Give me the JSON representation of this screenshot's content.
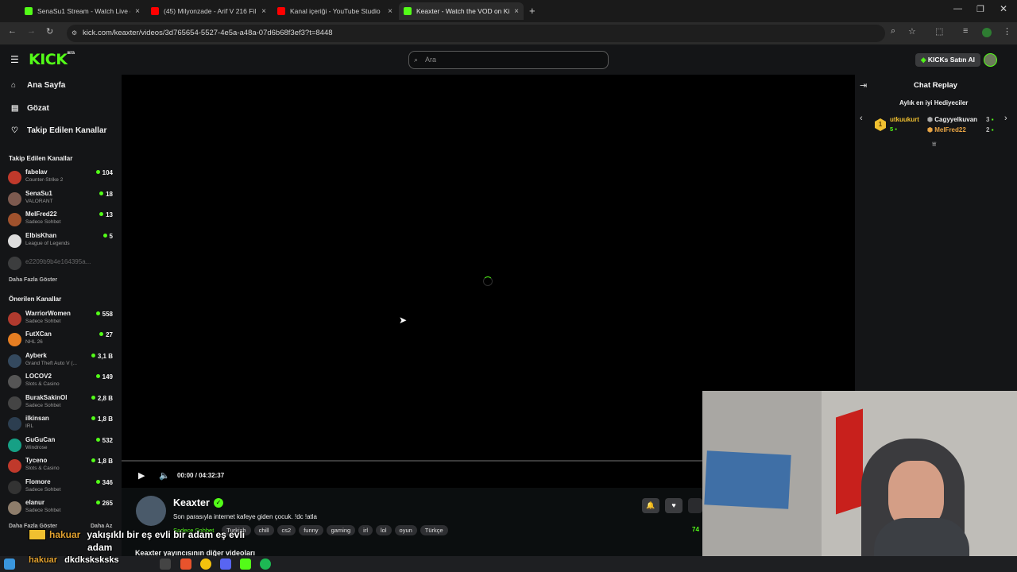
{
  "browser": {
    "tabs": [
      {
        "title": "SenaSu1 Stream - Watch Live o",
        "color": "#53fc18",
        "active": false
      },
      {
        "title": "(45) Milyonzade - Arif V 216 Fil",
        "color": "#ff0000",
        "active": false
      },
      {
        "title": "Kanal içeriği - YouTube Studio",
        "color": "#ff0000",
        "active": false
      },
      {
        "title": "Keaxter - Watch the VOD on Ki",
        "color": "#53fc18",
        "active": true
      }
    ],
    "new_tab_glyph": "+",
    "close_glyph": "×",
    "url": "kick.com/keaxter/videos/3d765654-5527-4e5a-a48a-07d6b68f3ef3?t=8448"
  },
  "header": {
    "logo_text": "KICK",
    "logo_sup": "BETA",
    "search_placeholder": "Ara",
    "buy_button": "KICKs Satın Al"
  },
  "sidebar": {
    "nav": [
      {
        "label": "Ana Sayfa",
        "icon": "home-icon",
        "glyph": "⌂"
      },
      {
        "label": "Gözat",
        "icon": "browse-icon",
        "glyph": "▤"
      },
      {
        "label": "Takip Edilen Kanallar",
        "icon": "heart-icon",
        "glyph": "♡"
      }
    ],
    "followed_heading": "Takip Edilen Kanallar",
    "followed": [
      {
        "name": "fabelav",
        "game": "Counter-Strike 2",
        "viewers": "104",
        "color": "#c0392b"
      },
      {
        "name": "SenaSu1",
        "game": "VALORANT",
        "viewers": "18",
        "color": "#7d5a4f"
      },
      {
        "name": "MelFred22",
        "game": "Sadece Sohbet",
        "viewers": "13",
        "color": "#a0522d"
      },
      {
        "name": "ElbisKhan",
        "game": "League of Legends",
        "viewers": "5",
        "color": "#dddddd"
      }
    ],
    "offline_channel": "e2209b9b4e164395a...",
    "show_more": "Daha Fazla Göster",
    "recommended_heading": "Önerilen Kanallar",
    "recommended": [
      {
        "name": "WarriorWomen",
        "game": "Sadece Sohbet",
        "viewers": "558",
        "color": "#b03a2e"
      },
      {
        "name": "FutXCan",
        "game": "NHL 26",
        "viewers": "27",
        "color": "#e67e22"
      },
      {
        "name": "Ayberk",
        "game": "Grand Theft Auto V (...",
        "viewers": "3,1 B",
        "color": "#34495e"
      },
      {
        "name": "LOCOV2",
        "game": "Slots & Casino",
        "viewers": "149",
        "color": "#555555"
      },
      {
        "name": "BurakSakinOl",
        "game": "Sadece Sohbet",
        "viewers": "2,8 B",
        "color": "#444444"
      },
      {
        "name": "ilkinsan",
        "game": "IRL",
        "viewers": "1,8 B",
        "color": "#2c3e50"
      },
      {
        "name": "GuGuCan",
        "game": "Windrose",
        "viewers": "532",
        "color": "#16a085"
      },
      {
        "name": "Tyceno",
        "game": "Slots & Casino",
        "viewers": "1,8 B",
        "color": "#c0392b"
      },
      {
        "name": "Flomore",
        "game": "Sadece Sohbet",
        "viewers": "346",
        "color": "#333333"
      },
      {
        "name": "elanur",
        "game": "Sadece Sohbet",
        "viewers": "265",
        "color": "#8e7d6b"
      }
    ],
    "show_more_2": "Daha Fazla Göster",
    "show_less": "Daha Az"
  },
  "player": {
    "time_current": "00:00",
    "time_separator": "/",
    "time_total": "04:32:37",
    "progress_fraction": 0.0
  },
  "stream": {
    "streamer": "Keaxter",
    "title": "Son parasıyla internet kafeye giden çocuk.  !dc !atla",
    "tags": [
      "Sadece Sohbet",
      "Turkish",
      "chill",
      "cs2",
      "funny",
      "gaming",
      "irl",
      "lol",
      "oyun",
      "Türkçe"
    ],
    "viewer_count": "74",
    "other_videos": "Keaxter yayıncısının diğer videoları"
  },
  "chat": {
    "title": "Chat Replay",
    "gifters_heading": "Aylık en iyi Hediyeciler",
    "top": {
      "rank": "1",
      "name": "utkuukurt",
      "count": "5"
    },
    "others": [
      {
        "name": "Cagyyelkuvan",
        "count": "3",
        "color": "#f0f0f0"
      },
      {
        "name": "MelFred22",
        "count": "2",
        "color": "#e8a444"
      }
    ]
  },
  "overlay": {
    "alert_user": "hakuar",
    "alert_message": "yakışıklı bir eş evli bir adam eş evli",
    "alert_message_2": "adam",
    "alert_user_2": "hakuar",
    "alert_message_3": "dkdksksksks"
  },
  "colors": {
    "accent": "#53fc18",
    "background": "#0b0e0f",
    "panel": "#141517"
  }
}
